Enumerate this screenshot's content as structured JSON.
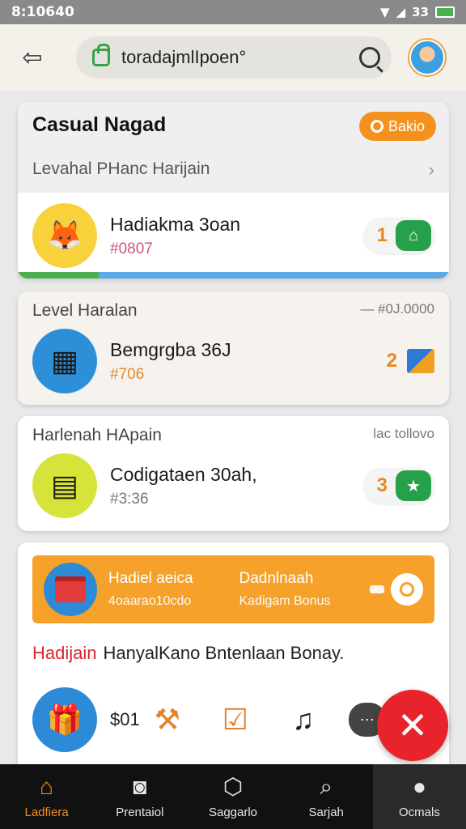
{
  "status": {
    "time": "8:10640",
    "battery": "33"
  },
  "browser": {
    "url": "toradajmlIpoen°"
  },
  "card1": {
    "title": "Casual Nagad",
    "pill": "Bakio",
    "subtitle": "Levahal PHanc Harijain",
    "item": {
      "title": "Hadiakma 3oan",
      "sub": "#0807",
      "count": "1"
    }
  },
  "card2": {
    "section": "Level Haralan",
    "meta": "— #0J.0000",
    "item": {
      "title": "Bemgrgba 36J",
      "sub": "#706",
      "count": "2"
    }
  },
  "card3": {
    "section": "Harlenah HApain",
    "meta": "lac tollovo",
    "item": {
      "title": "Codigataen 30ah,",
      "sub": "#3:36",
      "count": "3"
    }
  },
  "card4": {
    "banner": {
      "left_title": "Hadiel aeica",
      "left_sub": "4oaarao10cdo",
      "right_title": "Dadnlnaah",
      "right_sub": "Kadigam Bonus"
    },
    "promo_red": "Hadijain",
    "promo_text": "HanyalKano Bntenlaan Bonay.",
    "price": "$01"
  },
  "nav": [
    {
      "label": "Ladfiera",
      "icon": "home-icon"
    },
    {
      "label": "Prentaiol",
      "icon": "camera-icon"
    },
    {
      "label": "Saggarlo",
      "icon": "tag-icon"
    },
    {
      "label": "Sarjah",
      "icon": "search-icon"
    },
    {
      "label": "Ocmals",
      "icon": "profile-icon"
    }
  ],
  "colors": {
    "accent": "#f5921e",
    "danger": "#e8232b",
    "success": "#26a04a"
  }
}
